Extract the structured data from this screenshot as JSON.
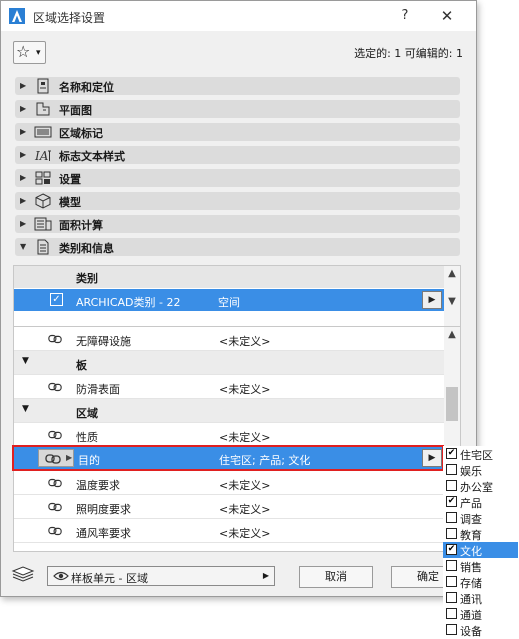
{
  "window": {
    "title": "区域选择设置",
    "help_label": "?",
    "close_label": "✕"
  },
  "toolbar": {
    "selection_info": "选定的: 1 可编辑的: 1"
  },
  "panels": [
    {
      "label": "名称和定位",
      "icon": "id-card-icon",
      "expanded": false
    },
    {
      "label": "平面图",
      "icon": "floor-plan-icon",
      "expanded": false
    },
    {
      "label": "区域标记",
      "icon": "zone-stamp-icon",
      "expanded": false
    },
    {
      "label": "标志文本样式",
      "icon": "text-style-icon",
      "expanded": false
    },
    {
      "label": "设置",
      "icon": "settings-grid-icon",
      "expanded": false
    },
    {
      "label": "模型",
      "icon": "model-cube-icon",
      "expanded": false
    },
    {
      "label": "面积计算",
      "icon": "area-calc-icon",
      "expanded": false
    },
    {
      "label": "类别和信息",
      "icon": "document-icon",
      "expanded": true
    }
  ],
  "category": {
    "header": "类别",
    "row_name": "ARCHICAD类别 - 22",
    "row_value": "空间",
    "checked": true
  },
  "parameters": [
    {
      "type": "param",
      "name": "无障碍设施",
      "value": "<未定义>"
    },
    {
      "type": "group",
      "name": "板"
    },
    {
      "type": "param",
      "name": "防滑表面",
      "value": "<未定义>"
    },
    {
      "type": "group",
      "name": "区域"
    },
    {
      "type": "param",
      "name": "性质",
      "value": "<未定义>"
    }
  ],
  "selected_param": {
    "name": "目的",
    "value": "住宅区; 产品; 文化"
  },
  "parameters_after": [
    {
      "type": "param",
      "name": "温度要求",
      "value": "<未定义>"
    },
    {
      "type": "param",
      "name": "照明度要求",
      "value": "<未定义>"
    },
    {
      "type": "param",
      "name": "通风率要求",
      "value": "<未定义>"
    }
  ],
  "bottom": {
    "layer_label": "样板单元 - 区域",
    "cancel_label": "取消",
    "ok_label": "确定"
  },
  "popup": {
    "items": [
      {
        "label": "住宅区",
        "checked": true,
        "highlighted": false
      },
      {
        "label": "娱乐",
        "checked": false,
        "highlighted": false
      },
      {
        "label": "办公室",
        "checked": false,
        "highlighted": false
      },
      {
        "label": "产品",
        "checked": true,
        "highlighted": false
      },
      {
        "label": "调查",
        "checked": false,
        "highlighted": false
      },
      {
        "label": "教育",
        "checked": false,
        "highlighted": false
      },
      {
        "label": "文化",
        "checked": true,
        "highlighted": true
      },
      {
        "label": "销售",
        "checked": false,
        "highlighted": false
      },
      {
        "label": "存储",
        "checked": false,
        "highlighted": false
      },
      {
        "label": "通讯",
        "checked": false,
        "highlighted": false
      },
      {
        "label": "通道",
        "checked": false,
        "highlighted": false
      },
      {
        "label": "设备",
        "checked": false,
        "highlighted": false
      }
    ]
  },
  "colors": {
    "selection": "#3a8ee6",
    "highlight_border": "#e02020",
    "panel_header": "#dcdcdc"
  }
}
